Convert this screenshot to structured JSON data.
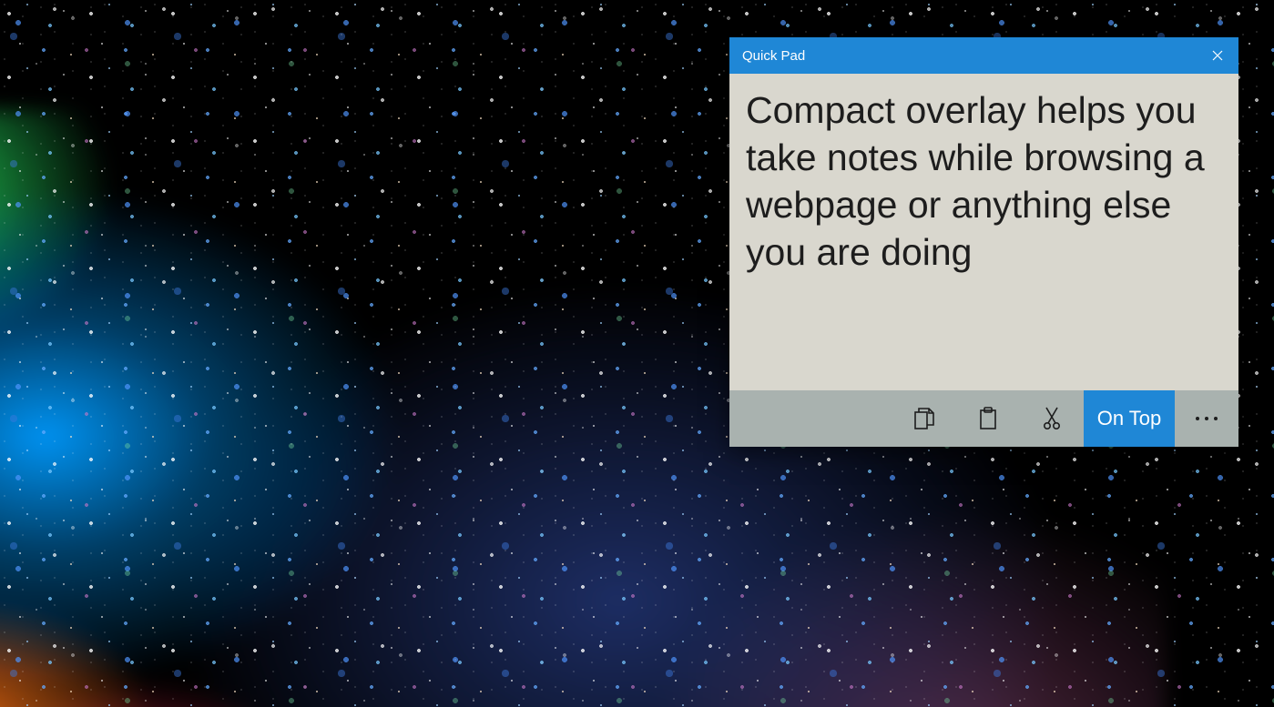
{
  "window": {
    "title": "Quick Pad",
    "note_text": "Compact overlay helps you take notes while browsing a webpage or anything else you are doing"
  },
  "toolbar": {
    "copy_label": "Copy",
    "paste_label": "Paste",
    "cut_label": "Cut",
    "on_top_label": "On Top",
    "more_label": "More"
  },
  "colors": {
    "accent": "#1f87d6",
    "note_bg": "#d9d7ce",
    "toolbar_bg": "#a9b2af"
  }
}
